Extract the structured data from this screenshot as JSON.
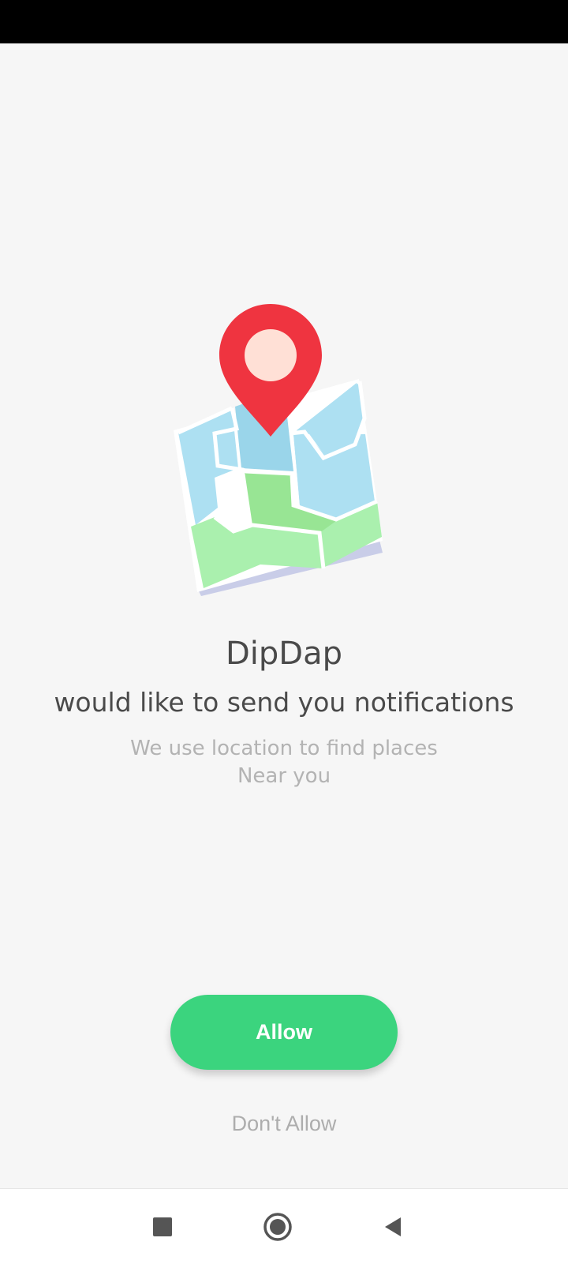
{
  "app": {
    "name": "DipDap"
  },
  "prompt": {
    "headline": "would like to send you notifications",
    "description_line1": "We use location to find places",
    "description_line2": "Near you"
  },
  "actions": {
    "allow_label": "Allow",
    "dont_allow_label": "Don't Allow"
  },
  "illustration": {
    "icon": "map-with-location-pin-icon"
  },
  "navigation": {
    "recents_icon": "square-icon",
    "home_icon": "circle-home-icon",
    "back_icon": "triangle-back-icon"
  },
  "colors": {
    "accent": "#3bd47e",
    "pin": "#ef3440",
    "background": "#f6f6f6"
  }
}
